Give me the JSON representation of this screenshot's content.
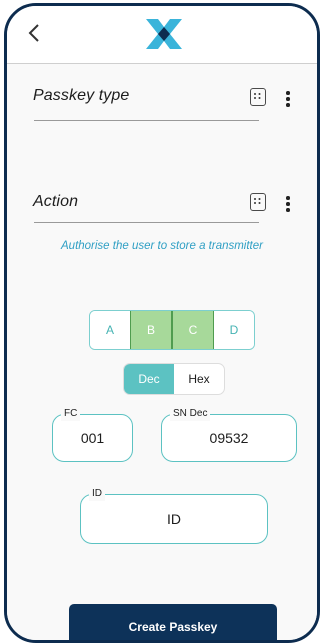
{
  "header": {
    "back_icon": "chevron-left-icon",
    "logo_icon": "x-logo-icon"
  },
  "fields": {
    "passkey_type": {
      "label": "Passkey type",
      "value": "",
      "keypad_icon": "keypad-icon",
      "menu_icon": "more-vertical-icon"
    },
    "action": {
      "label": "Action",
      "value": "",
      "keypad_icon": "keypad-icon",
      "menu_icon": "more-vertical-icon"
    }
  },
  "hint_text": "Authorise the user to store a transmitter",
  "segment": {
    "options": [
      "A",
      "B",
      "C",
      "D"
    ],
    "selected": [
      "B",
      "C"
    ]
  },
  "format_toggle": {
    "options": [
      "Dec",
      "Hex"
    ],
    "selected": "Dec"
  },
  "inputs": {
    "fc": {
      "label": "FC",
      "value": "001"
    },
    "sn_dec": {
      "label": "SN Dec",
      "value": "09532"
    },
    "id": {
      "label": "ID",
      "value": "ID"
    }
  },
  "create_button": {
    "label": "Create Passkey"
  },
  "colors": {
    "primary": "#0d3259",
    "accent_teal": "#5cc2c2",
    "selected_green": "#a7d99a",
    "hint_blue": "#2f9fc4"
  }
}
